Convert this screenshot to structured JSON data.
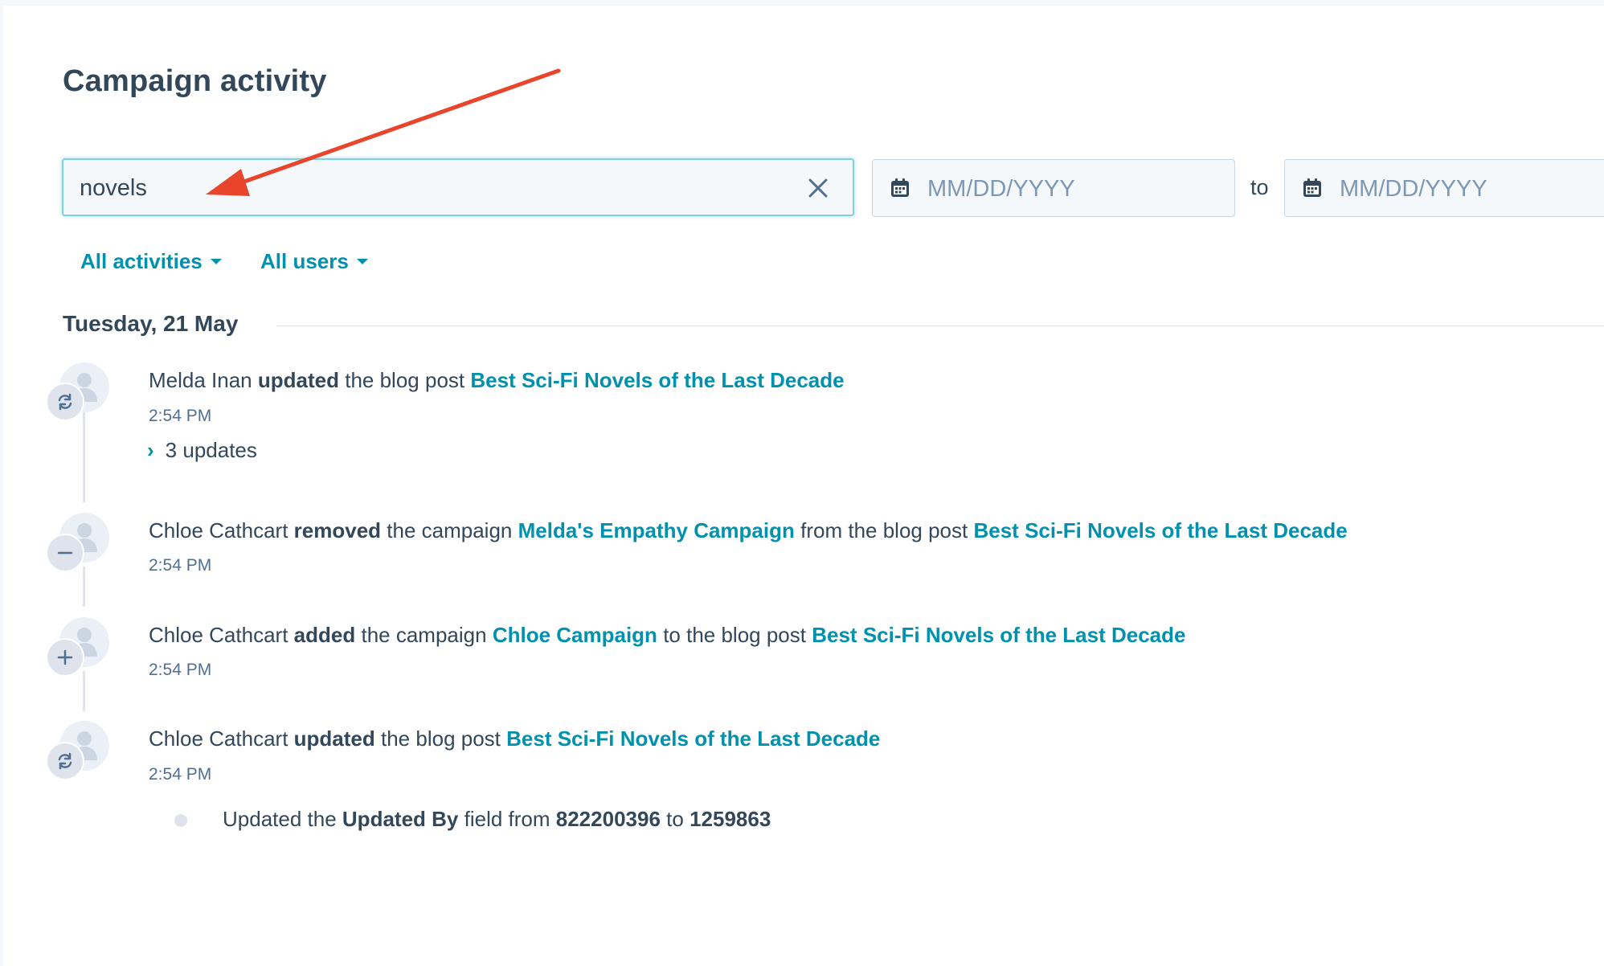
{
  "page": {
    "title": "Campaign activity"
  },
  "search": {
    "value": "novels"
  },
  "date_range": {
    "from_placeholder": "MM/DD/YYYY",
    "to_label": "to",
    "to_placeholder": "MM/DD/YYYY"
  },
  "filters": {
    "activities": "All activities",
    "users": "All users"
  },
  "day_heading": "Tuesday, 21 May",
  "colors": {
    "accent": "#0091ae",
    "text": "#33475b",
    "annotation_arrow": "#e8452c",
    "focus_border": "#7fd1de"
  },
  "activities": [
    {
      "badge_icon": "refresh-icon",
      "actor": "Melda Inan",
      "verb": "updated",
      "text_a": "the blog post",
      "link_a": "Best Sci-Fi Novels of the Last Decade",
      "time": "2:54 PM",
      "expander": "3 updates"
    },
    {
      "badge_icon": "minus-icon",
      "actor": "Chloe Cathcart",
      "verb": "removed",
      "text_a": "the campaign",
      "link_a": "Melda's Empathy Campaign",
      "text_b": "from the blog post",
      "link_b": "Best Sci-Fi Novels of the Last Decade",
      "time": "2:54 PM"
    },
    {
      "badge_icon": "plus-icon",
      "actor": "Chloe Cathcart",
      "verb": "added",
      "text_a": "the campaign",
      "link_a": "Chloe Campaign",
      "text_b": "to the blog post",
      "link_b": "Best Sci-Fi Novels of the Last Decade",
      "time": "2:54 PM"
    },
    {
      "badge_icon": "refresh-icon",
      "actor": "Chloe Cathcart",
      "verb": "updated",
      "text_a": "the blog post",
      "link_a": "Best Sci-Fi Novels of the Last Decade",
      "time": "2:54 PM",
      "detail": {
        "prefix": "Updated the",
        "field": "Updated By",
        "mid": "field from",
        "from_value": "822200396",
        "to_word": "to",
        "to_value": "1259863"
      }
    }
  ]
}
